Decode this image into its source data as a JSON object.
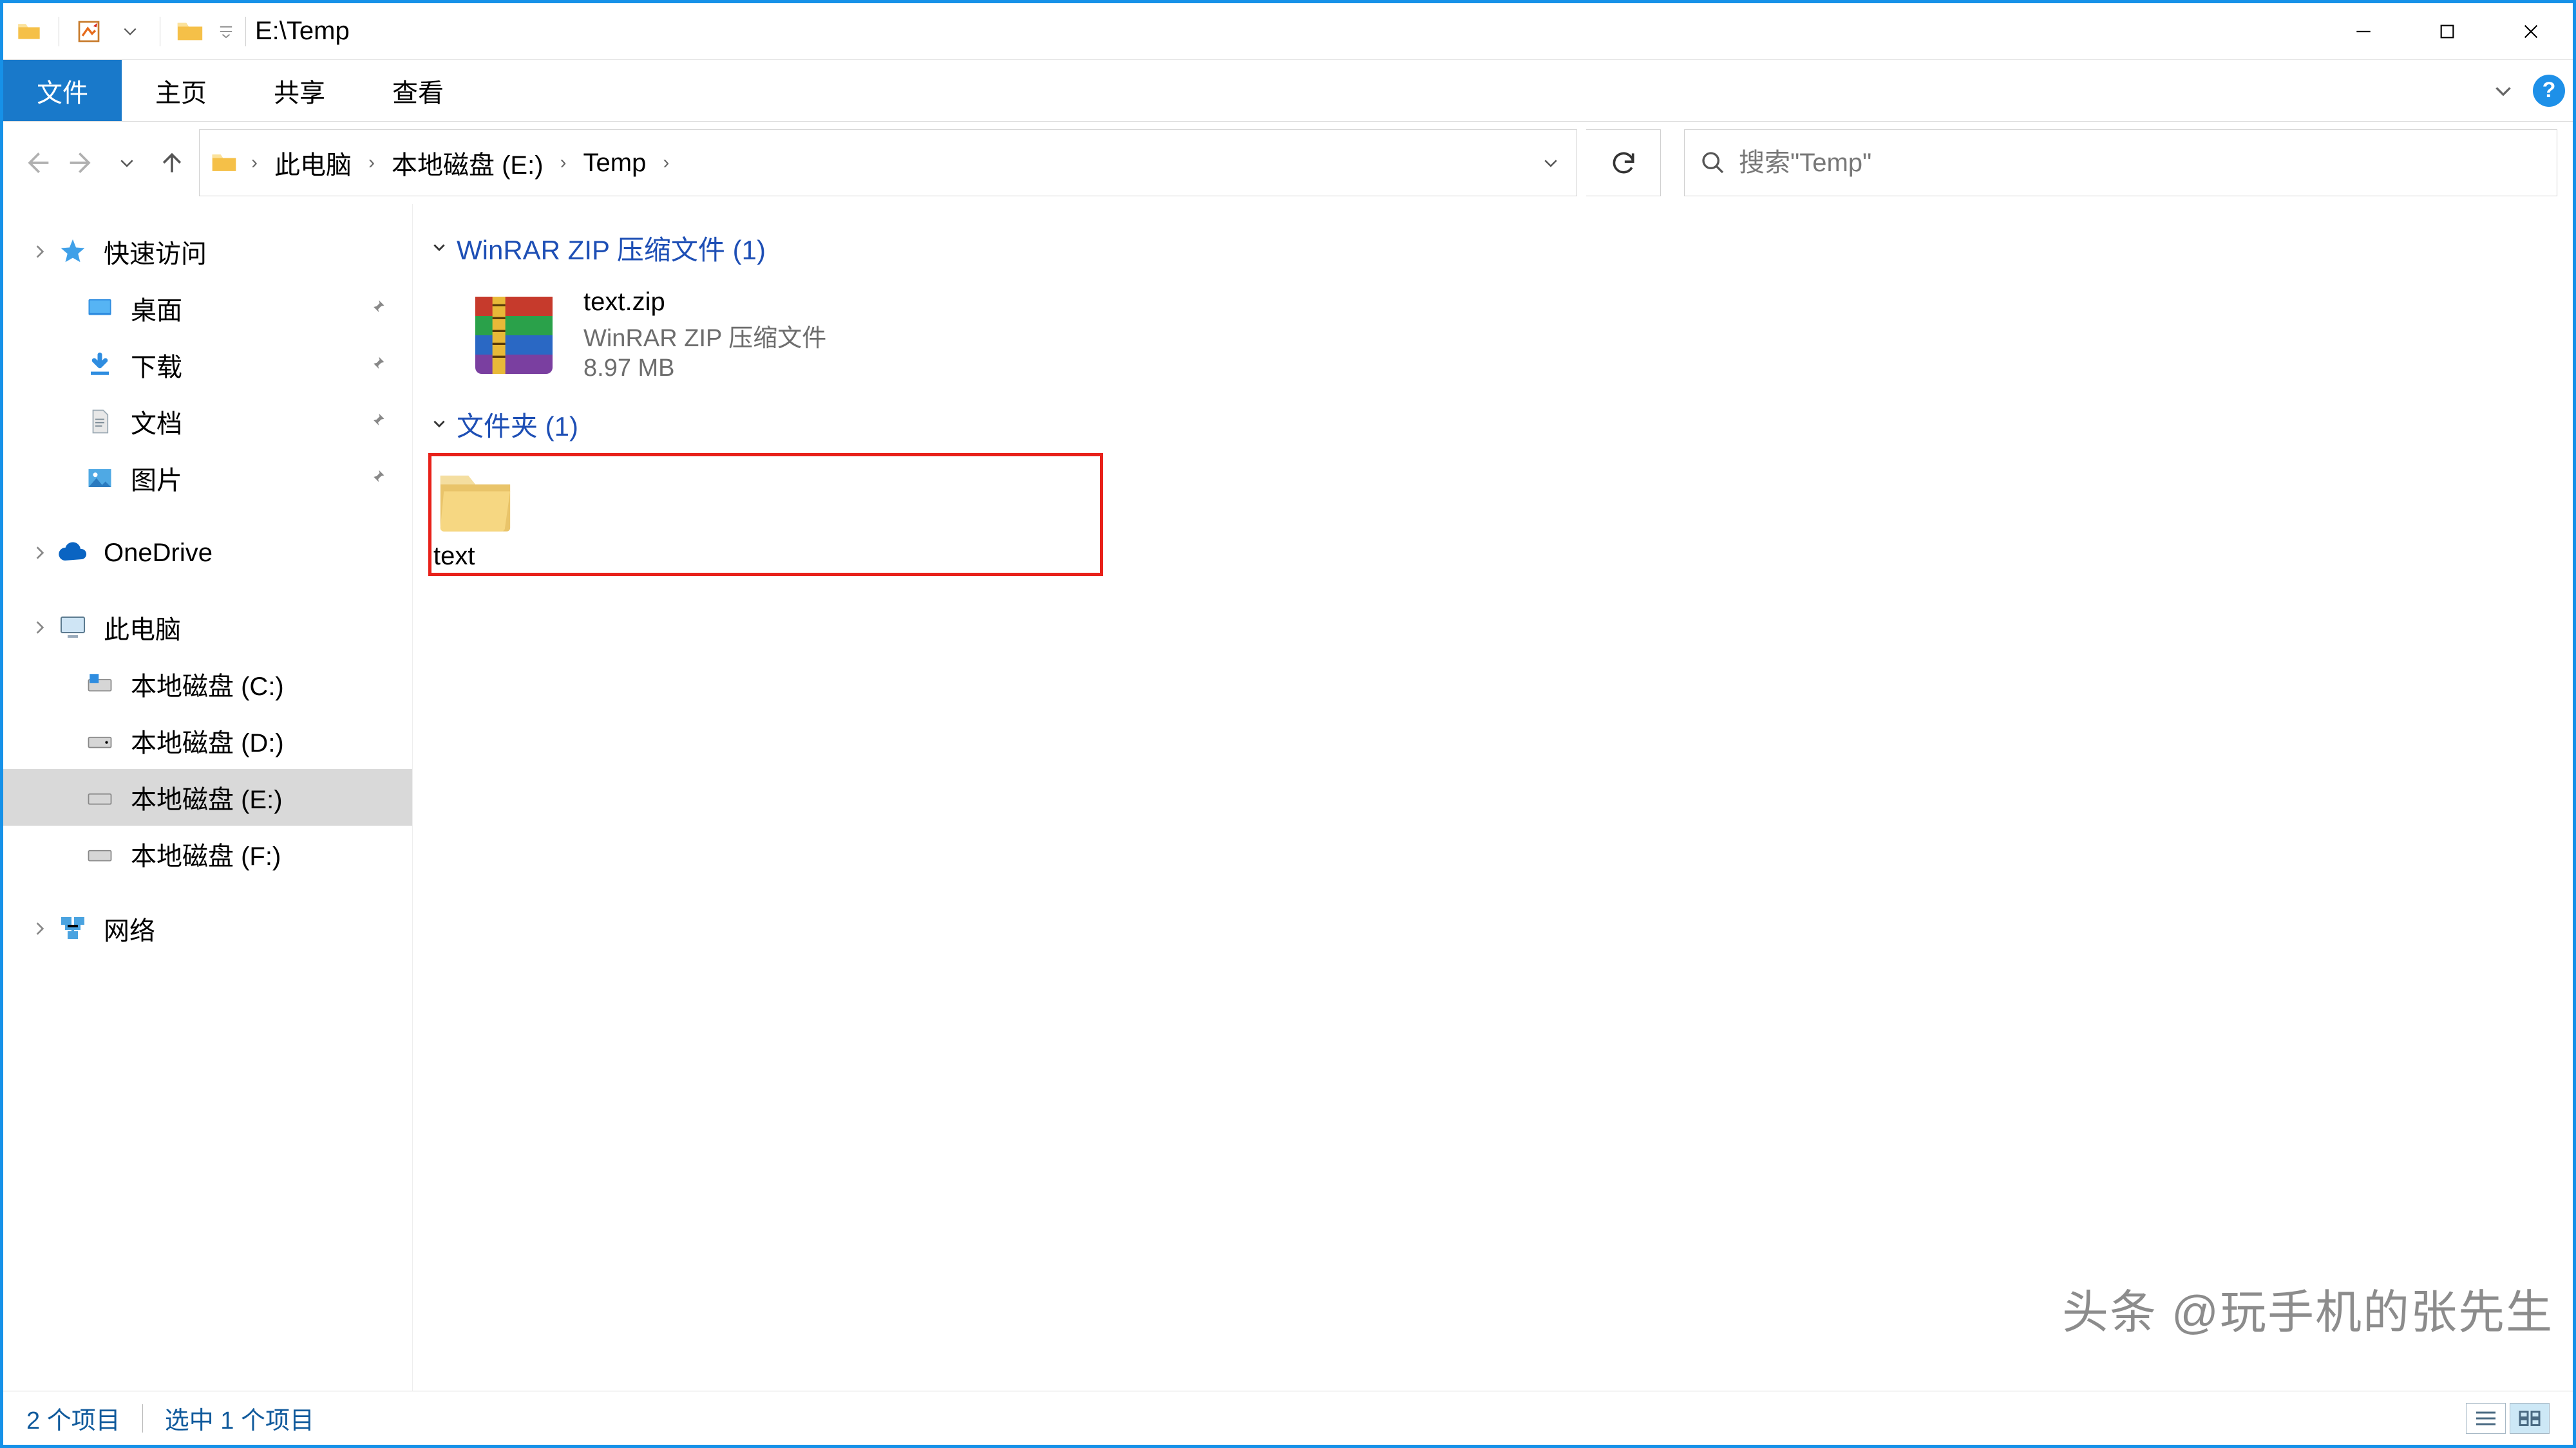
{
  "title": "E:\\Temp",
  "ribbon": {
    "file": "文件",
    "tabs": [
      "主页",
      "共享",
      "查看"
    ]
  },
  "breadcrumb": [
    "此电脑",
    "本地磁盘 (E:)",
    "Temp"
  ],
  "search_placeholder": "搜索\"Temp\"",
  "sidebar": {
    "quick_access": "快速访问",
    "quick_items": [
      {
        "label": "桌面",
        "icon": "desktop"
      },
      {
        "label": "下载",
        "icon": "download"
      },
      {
        "label": "文档",
        "icon": "document"
      },
      {
        "label": "图片",
        "icon": "picture"
      }
    ],
    "onedrive": "OneDrive",
    "this_pc": "此电脑",
    "drives": [
      {
        "label": "本地磁盘 (C:)",
        "icon": "drive-win"
      },
      {
        "label": "本地磁盘 (D:)",
        "icon": "drive"
      },
      {
        "label": "本地磁盘 (E:)",
        "icon": "drive",
        "selected": true
      },
      {
        "label": "本地磁盘 (F:)",
        "icon": "drive"
      }
    ],
    "network": "网络"
  },
  "groups": [
    {
      "header": "WinRAR ZIP 压缩文件 (1)",
      "items": [
        {
          "name": "text.zip",
          "type": "WinRAR ZIP 压缩文件",
          "size": "8.97 MB",
          "icon": "winrar",
          "selected": false,
          "highlight": false
        }
      ]
    },
    {
      "header": "文件夹 (1)",
      "items": [
        {
          "name": "text",
          "type": "",
          "size": "",
          "icon": "folder",
          "selected": true,
          "highlight": true
        }
      ]
    }
  ],
  "status": {
    "items": "2 个项目",
    "selected": "选中 1 个项目"
  },
  "watermark": "头条 @玩手机的张先生"
}
